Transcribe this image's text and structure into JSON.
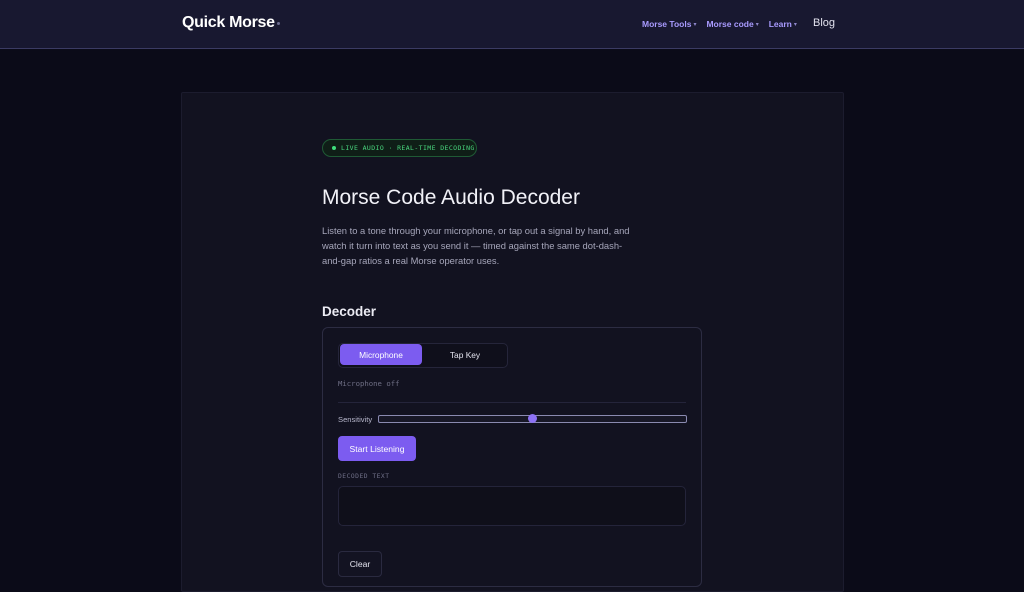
{
  "nav": {
    "logo": "Quick Morse",
    "items": [
      {
        "label": "Morse Tools"
      },
      {
        "label": "Morse code"
      },
      {
        "label": "Learn"
      }
    ],
    "blog": "Blog"
  },
  "hero": {
    "badge": "LIVE AUDIO · REAL-TIME DECODING",
    "title": "Morse Code Audio Decoder",
    "description": "Listen to a tone through your microphone, or tap out a signal by hand, and watch it turn into text as you send it — timed against the same dot-dash-and-gap ratios a real Morse operator uses."
  },
  "decoder": {
    "section_title": "Decoder",
    "tabs": [
      {
        "label": "Microphone",
        "active": true
      },
      {
        "label": "Tap Key",
        "active": false
      }
    ],
    "status": "Microphone off",
    "sensitivity_label": "Sensitivity",
    "sensitivity_value": 0.5,
    "start_label": "Start Listening",
    "decoded_label": "DECODED TEXT",
    "decoded_value": "",
    "clear_label": "Clear"
  },
  "colors": {
    "accent": "#7c5cf0",
    "badge_green": "#49d67e",
    "nav_link": "#a99bff"
  }
}
